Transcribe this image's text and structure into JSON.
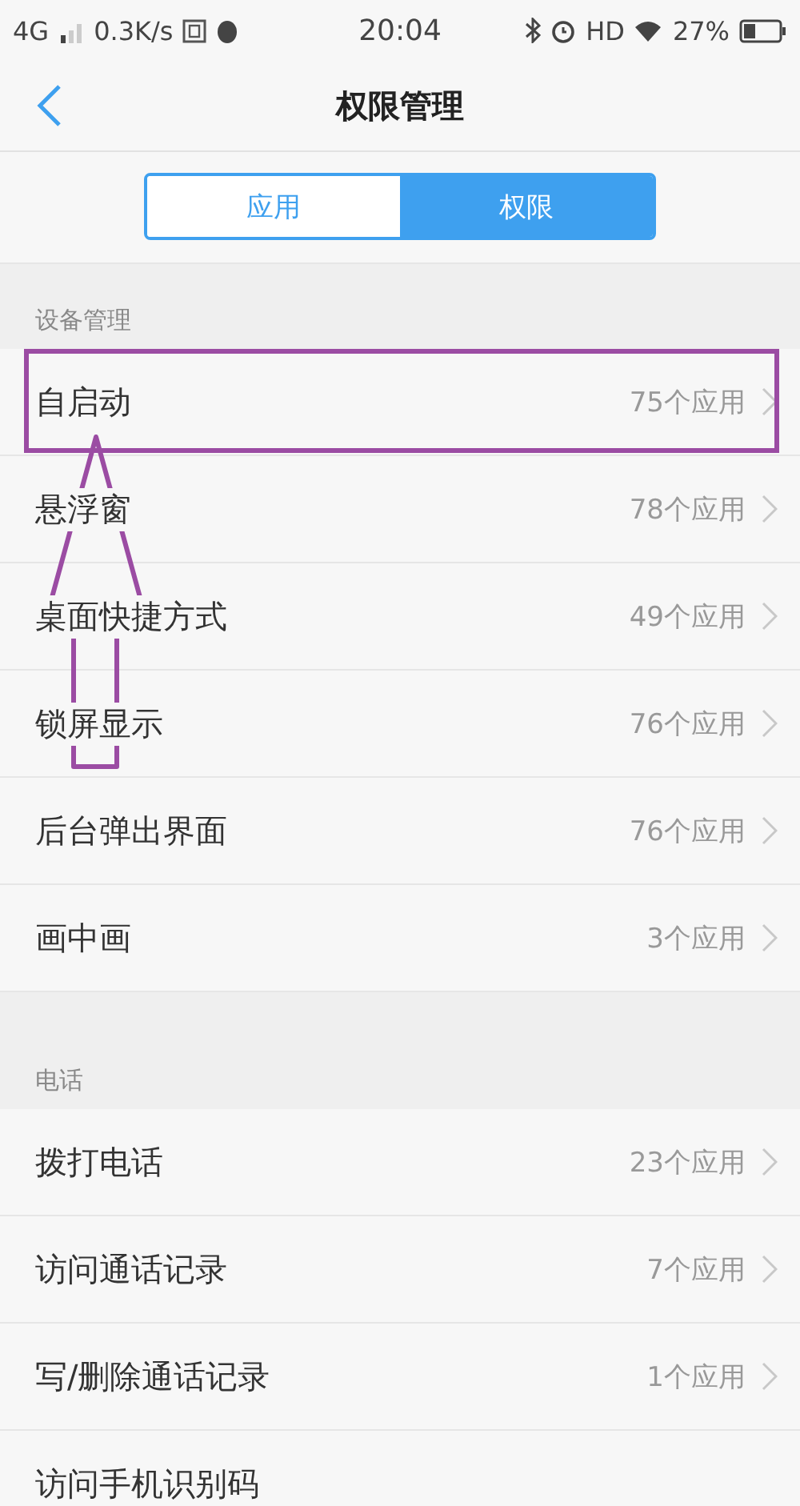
{
  "status_bar": {
    "network": "4G",
    "speed": "0.3K/s",
    "time": "20:04",
    "hd": "HD",
    "battery": "27%"
  },
  "header": {
    "title": "权限管理"
  },
  "tabs": [
    {
      "label": "应用",
      "selected": false
    },
    {
      "label": "权限",
      "selected": true
    }
  ],
  "sections": [
    {
      "title": "设备管理",
      "items": [
        {
          "label": "自启动",
          "count": "75个应用",
          "highlighted": true
        },
        {
          "label": "悬浮窗",
          "count": "78个应用",
          "highlighted": false
        },
        {
          "label": "桌面快捷方式",
          "count": "49个应用",
          "highlighted": false
        },
        {
          "label": "锁屏显示",
          "count": "76个应用",
          "highlighted": false
        },
        {
          "label": "后台弹出界面",
          "count": "76个应用",
          "highlighted": false
        },
        {
          "label": "画中画",
          "count": "3个应用",
          "highlighted": false
        }
      ]
    },
    {
      "title": "电话",
      "items": [
        {
          "label": "拨打电话",
          "count": "23个应用",
          "highlighted": false
        },
        {
          "label": "访问通话记录",
          "count": "7个应用",
          "highlighted": false
        },
        {
          "label": "写/删除通话记录",
          "count": "1个应用",
          "highlighted": false
        },
        {
          "label": "访问手机识别码",
          "highlighted": false
        }
      ]
    }
  ]
}
